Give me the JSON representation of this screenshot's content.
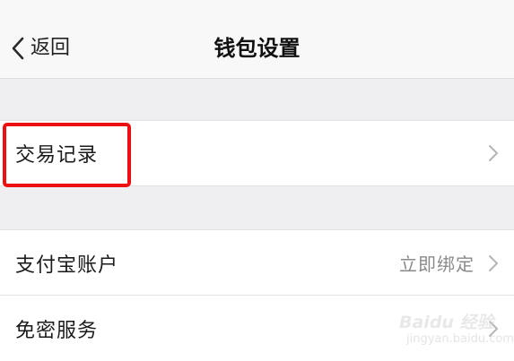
{
  "nav": {
    "back_label": "返回",
    "title": "钱包设置"
  },
  "rows": [
    {
      "label": "交易记录",
      "value": ""
    },
    {
      "label": "支付宝账户",
      "value": "立即绑定"
    },
    {
      "label": "免密服务",
      "value": ""
    }
  ],
  "watermark": {
    "brand": "Baidu 经验",
    "url": "jingyan.baidu.com"
  },
  "colors": {
    "highlight": "#ee1010",
    "background": "#efeff2",
    "row": "#ffffff",
    "secondary_text": "#8a8a8a"
  }
}
